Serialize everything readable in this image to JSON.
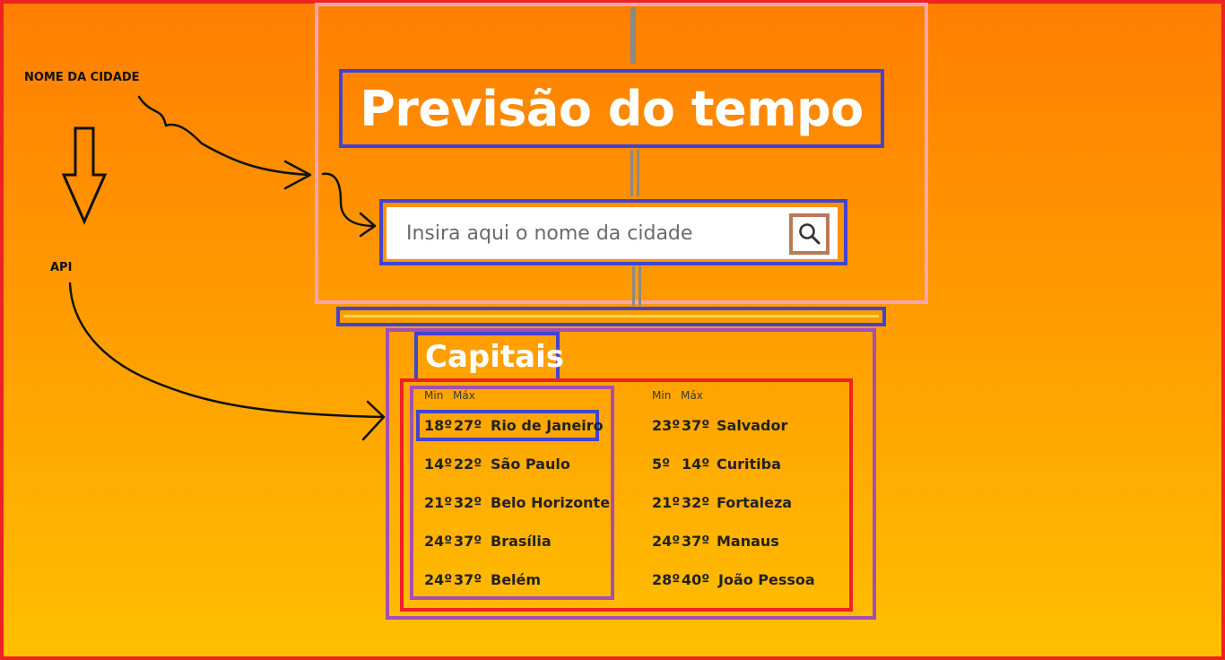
{
  "header": {
    "title": "Previsão do tempo"
  },
  "search": {
    "placeholder": "Insira aqui o nome da cidade",
    "button_icon": "search-icon"
  },
  "capitais": {
    "title": "Capitais",
    "col_min": "Min",
    "col_max": "Máx",
    "left": [
      {
        "min": "18º",
        "max": "27º",
        "city": "Rio de Janeiro"
      },
      {
        "min": "14º",
        "max": "22º",
        "city": "São Paulo"
      },
      {
        "min": "21º",
        "max": "32º",
        "city": "Belo Horizonte"
      },
      {
        "min": "24º",
        "max": "37º",
        "city": "Brasília"
      },
      {
        "min": "24º",
        "max": "37º",
        "city": "Belém"
      }
    ],
    "right": [
      {
        "min": "23º",
        "max": "37º",
        "city": "Salvador"
      },
      {
        "min": "5º",
        "max": "14º",
        "city": "Curitiba"
      },
      {
        "min": "21º",
        "max": "32º",
        "city": "Fortaleza"
      },
      {
        "min": "24º",
        "max": "37º",
        "city": "Manaus"
      },
      {
        "min": "28º",
        "max": "40º",
        "city": "João Pessoa"
      }
    ]
  },
  "annotations": {
    "city_name": "NOME DA CIDADE",
    "api": "API"
  },
  "colors": {
    "frame_red": "#ee2222",
    "frame_blue": "#4343d0",
    "frame_purple": "#a54fb0",
    "frame_pink": "#f4a6b8",
    "gradient_top": "#ff7e00",
    "gradient_bottom": "#ffc000"
  }
}
